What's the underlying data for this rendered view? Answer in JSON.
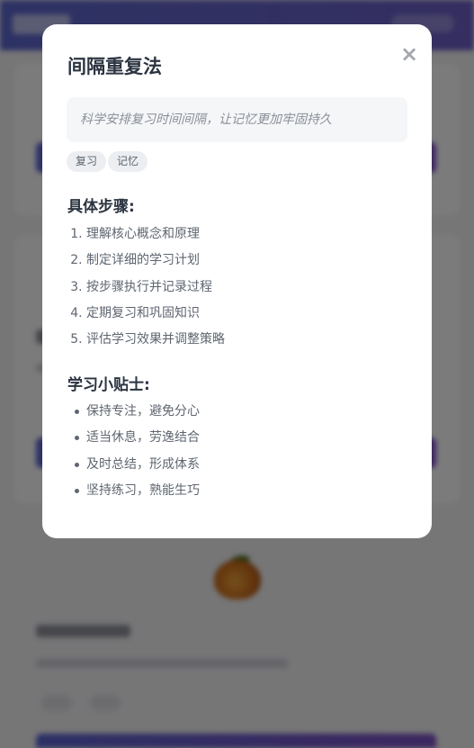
{
  "modal": {
    "title": "间隔重复法",
    "close_label": "×",
    "description": "科学安排复习时间间隔，让记忆更加牢固持久",
    "tags": [
      "复习",
      "记忆"
    ],
    "steps_title": "具体步骤:",
    "steps": [
      "理解核心概念和原理",
      "制定详细的学习计划",
      "按步骤执行并记录过程",
      "定期复习和巩固知识",
      "评估学习效果并调整策略"
    ],
    "tips_title": "学习小贴士:",
    "tips": [
      "保持专注，避免分心",
      "适当休息，劳逸结合",
      "及时总结，形成体系",
      "坚持练习，熟能生巧"
    ]
  },
  "colors": {
    "header_gradient_start": "#5a64c8",
    "button_gradient_end": "#7a4fc0",
    "title_text": "#2b3440",
    "body_text": "#5f6670"
  }
}
